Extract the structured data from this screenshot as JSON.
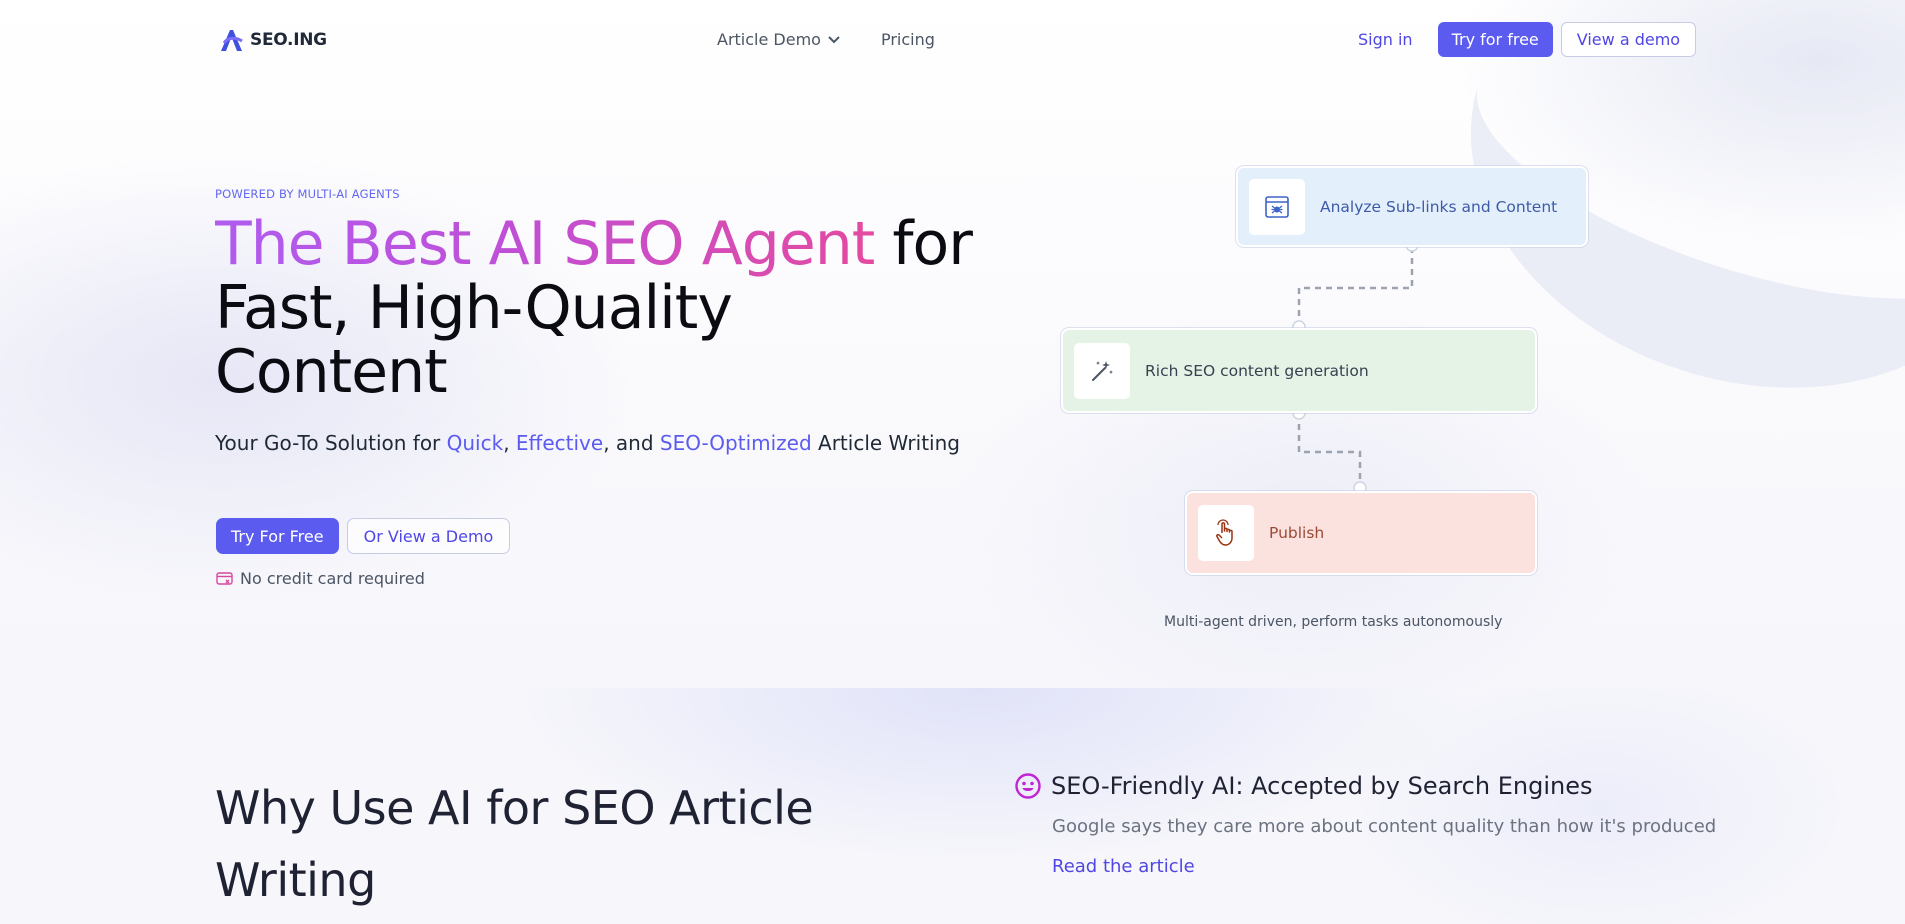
{
  "nav": {
    "logo_text": "SEO.ING",
    "links": [
      {
        "label": "Article Demo",
        "has_dropdown": true
      },
      {
        "label": "Pricing",
        "has_dropdown": false
      }
    ],
    "sign_in": "Sign in",
    "try_free": "Try for free",
    "view_demo": "View a demo"
  },
  "hero": {
    "eyebrow": "POWERED BY MULTI-AI AGENTS",
    "title_highlight": "The Best AI SEO Agent",
    "title_rest": " for Fast, High-Quality Content",
    "subtitle": {
      "prefix": "Your Go-To Solution for ",
      "quick": "Quick",
      "sep1": ", ",
      "effective": "Effective",
      "sep2": ", and ",
      "seo_optimized": "SEO-Optimized",
      "suffix": " Article Writing"
    },
    "cta_primary": "Try For Free",
    "cta_secondary": "Or View a Demo",
    "no_credit_card": "No credit card required"
  },
  "diagram": {
    "steps": [
      {
        "label": "Analyze Sub-links and Content",
        "icon": "spider-web-icon"
      },
      {
        "label": "Rich SEO content generation",
        "icon": "magic-wand-icon"
      },
      {
        "label": "Publish",
        "icon": "pointer-hand-icon"
      }
    ],
    "caption": "Multi-agent driven, perform tasks autonomously"
  },
  "why": {
    "heading": "Why Use AI for SEO Article Writing",
    "feature_title": "SEO-Friendly AI: Accepted by Search Engines",
    "feature_desc": "Google says they care more about content quality than how it's produced",
    "feature_link": "Read the article"
  },
  "colors": {
    "accent": "#5b5bf0",
    "gradient_start": "#b05cf0",
    "gradient_end": "#e44aa0",
    "step1_bg": "#e4effc",
    "step2_bg": "#e5f3e6",
    "step3_bg": "#fbe2df"
  }
}
